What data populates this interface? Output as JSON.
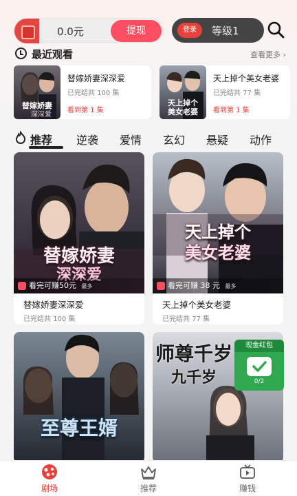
{
  "header": {
    "balance": "0.0元",
    "withdraw_label": "提现",
    "login_label": "登录",
    "level_label": "等级1"
  },
  "recent": {
    "title": "最近观看",
    "more_label": "查看更多",
    "items": [
      {
        "title": "替嫁娇妻深深爱",
        "episodes": "已完结共 100 集",
        "progress": "看到第 1 集"
      },
      {
        "title": "天上掉个美女老婆",
        "episodes": "已完结共 77 集",
        "progress": "看到第 1 集"
      }
    ]
  },
  "tabs": [
    "推荐",
    "逆袭",
    "爱情",
    "玄幻",
    "悬疑",
    "动作"
  ],
  "cards": [
    {
      "title": "替嫁娇妻深深爱",
      "episodes": "已完结共 100 集",
      "reward": "看完可赚50元",
      "reward_max": "最多",
      "poster_line1": "替嫁娇妻",
      "poster_line2": "深深爱"
    },
    {
      "title": "天上掉个美女老婆",
      "episodes": "已完结共 77 集",
      "reward": "看完可赚 38 元",
      "reward_max": "最多",
      "poster_line1": "天上掉个",
      "poster_line2": "美女老婆"
    },
    {
      "poster_line1": "至尊王婿"
    },
    {
      "poster_line1": "师尊千岁",
      "poster_line2": "九千岁"
    }
  ],
  "promo": {
    "label": "现金红包",
    "count": "0/2"
  },
  "nav": {
    "items": [
      {
        "label": "剧场",
        "icon": "theater-icon"
      },
      {
        "label": "推荐",
        "icon": "crown-icon"
      },
      {
        "label": "赚钱",
        "icon": "tv-icon"
      }
    ]
  },
  "colors": {
    "accent": "#ff4e61",
    "dark": "#444444",
    "promo": "#2fa84f"
  }
}
